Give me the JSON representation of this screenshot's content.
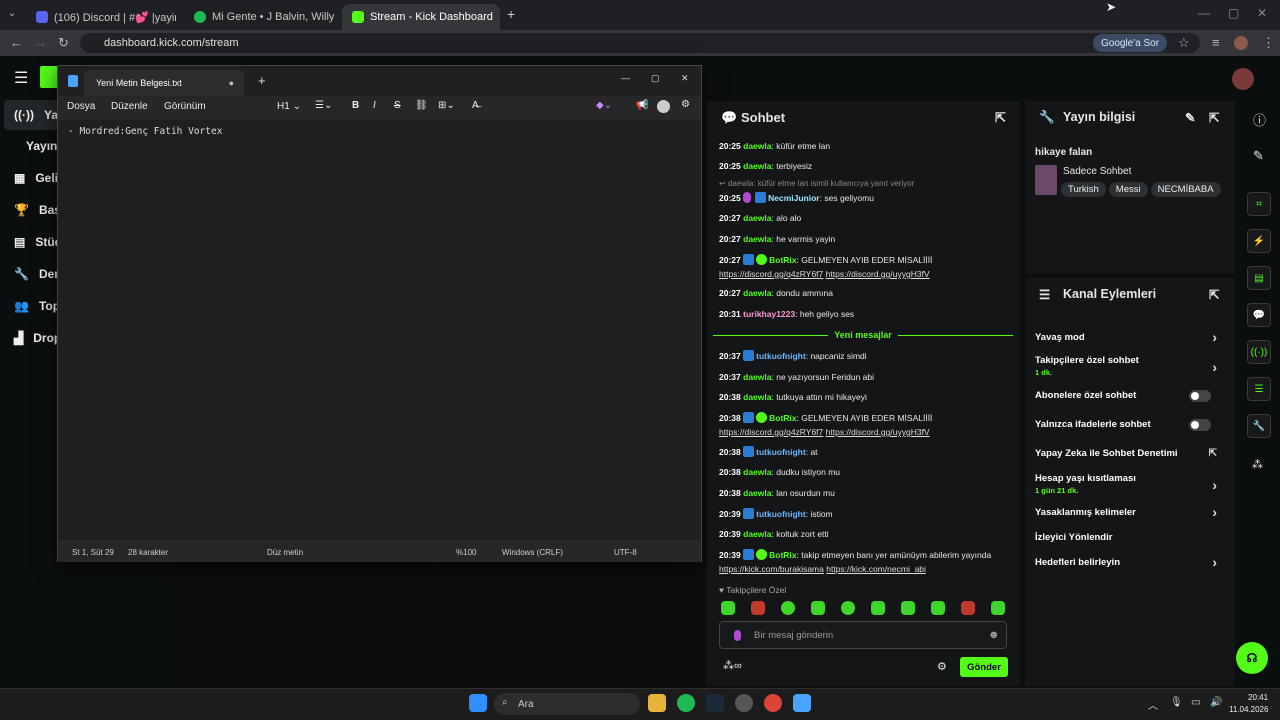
{
  "browser": {
    "tabs": [
      {
        "title": "(106) Discord | #💕 |yayin-duy",
        "color": "#5865f2",
        "active": false
      },
      {
        "title": "Mi Gente • J Balvin, Willy W",
        "color": "#1db954",
        "active": false
      },
      {
        "title": "Stream - Kick Dashboard",
        "color": "#53fc18",
        "active": true
      }
    ],
    "url": "dashboard.kick.com/stream",
    "google_button": "Google'a Sor"
  },
  "sidenav": {
    "items": [
      {
        "label": "Yayı",
        "icon": "broadcast-icon"
      },
      {
        "label": "Yayın",
        "icon": ""
      },
      {
        "label": "Geli",
        "icon": "chart-icon"
      },
      {
        "label": "Başa",
        "icon": "trophy-icon"
      },
      {
        "label": "Stüd",
        "icon": "studio-icon"
      },
      {
        "label": "Den",
        "icon": "wrench-icon"
      },
      {
        "label": "Top",
        "icon": "community-icon"
      },
      {
        "label": "Drop",
        "icon": "drops-icon"
      }
    ]
  },
  "notepad": {
    "tab_title": "Yeni Metin Belgesi.txt",
    "menu": [
      "Dosya",
      "Düzenle",
      "Görünüm"
    ],
    "heading_select": "H1",
    "content": "- Mordred:Genç Fatih Vortex",
    "status": {
      "position": "St 1, Süt 29",
      "chars": "28 karakter",
      "format": "Düz metin",
      "zoom": "%100",
      "eol": "Windows (CRLF)",
      "encoding": "UTF-8"
    }
  },
  "chat": {
    "title": "Sohbet",
    "reply_hint": "daewla: küfür etme lan isimli kullanıcıya yanıt veriyor",
    "new_messages": "Yeni mesajlar",
    "followers_only": "Takipçilere Özel",
    "input_placeholder": "Bir mesaj gönderin",
    "send": "Gönder",
    "messages": [
      {
        "time": "20:25",
        "user": "daewla",
        "cls": "u-g",
        "text": "küfür etme lan"
      },
      {
        "time": "20:25",
        "user": "daewla",
        "cls": "u-g",
        "text": "terbiyesiz"
      },
      {
        "time": "20:25",
        "user": "NecmiJunior",
        "cls": "u-n",
        "text": "ses geliyomu"
      },
      {
        "time": "20:27",
        "user": "daewla",
        "cls": "u-g",
        "text": "alo alo"
      },
      {
        "time": "20:27",
        "user": "daewla",
        "cls": "u-g",
        "text": "he varmis yayin"
      },
      {
        "time": "20:27",
        "user": "BotRix",
        "cls": "u-g",
        "text": "GELMEYEN AYIB EDER MİSALİİİİ",
        "links": [
          "https://discord.gg/q4zRY6f7",
          "https://discord.gg/uyygH3fV"
        ]
      },
      {
        "time": "20:27",
        "user": "daewla",
        "cls": "u-g",
        "text": "dondu ammına"
      },
      {
        "time": "20:31",
        "user": "turikhay1223",
        "cls": "u-p",
        "text": "heh geliyo ses"
      },
      {
        "time": "20:37",
        "user": "tutkuofnight",
        "cls": "u-b",
        "text": "napcaniz simdi"
      },
      {
        "time": "20:37",
        "user": "daewla",
        "cls": "u-g",
        "text": "ne yazıyorsun Feridun abi"
      },
      {
        "time": "20:38",
        "user": "daewla",
        "cls": "u-g",
        "text": "tutkuya attın mi hikayeyi"
      },
      {
        "time": "20:38",
        "user": "BotRix",
        "cls": "u-g",
        "text": "GELMEYEN AYIB EDER MİSALİİİİ",
        "links": [
          "https://discord.gg/q4zRY6f7",
          "https://discord.gg/uyygH3fV"
        ]
      },
      {
        "time": "20:38",
        "user": "tutkuofnight",
        "cls": "u-b",
        "text": "at"
      },
      {
        "time": "20:38",
        "user": "daewla",
        "cls": "u-g",
        "text": "dudku istiyon mu"
      },
      {
        "time": "20:38",
        "user": "daewla",
        "cls": "u-g",
        "text": "lan osurdun mu"
      },
      {
        "time": "20:39",
        "user": "tutkuofnight",
        "cls": "u-b",
        "text": "istiom"
      },
      {
        "time": "20:39",
        "user": "daewla",
        "cls": "u-g",
        "text": "koltuk zort etti"
      },
      {
        "time": "20:39",
        "user": "BotRix",
        "cls": "u-g",
        "text": "takip etmeyen banı yer amünüym abilerim yayında",
        "links": [
          "https://kick.com/burakisama",
          "https://kick.com/necmi_abi"
        ]
      }
    ]
  },
  "stream_info": {
    "title": "Yayın bilgisi",
    "stream_title": "hikaye falan",
    "category": "Sadece Sohbet",
    "tags": [
      "Turkish",
      "Messi",
      "NECMİBABA"
    ]
  },
  "channel_actions": {
    "title": "Kanal Eylemleri",
    "items": [
      {
        "label": "Yavaş mod",
        "sub": "",
        "ctrl": "chev"
      },
      {
        "label": "Takipçilere özel sohbet",
        "sub": "1 dk.",
        "ctrl": "chev"
      },
      {
        "label": "Abonelere özel sohbet",
        "sub": "",
        "ctrl": "toggle"
      },
      {
        "label": "Yalnızca ifadelerle sohbet",
        "sub": "",
        "ctrl": "toggle"
      },
      {
        "label": "Yapay Zeka ile Sohbet Denetimi",
        "sub": "",
        "ctrl": "ext"
      },
      {
        "label": "Hesap yaşı kısıtlaması",
        "sub": "1 gün 21 dk.",
        "ctrl": "chev"
      },
      {
        "label": "Yasaklanmış kelimeler",
        "sub": "",
        "ctrl": "chev"
      },
      {
        "label": "İzleyici Yönlendir",
        "sub": "",
        "ctrl": "none"
      },
      {
        "label": "Hedefleri belirleyin",
        "sub": "",
        "ctrl": "chev"
      }
    ]
  },
  "taskbar": {
    "search": "Ara",
    "time": "20:41",
    "date": "11.04.2026"
  },
  "colors": {
    "accent": "#53fc18",
    "bg": "#0b0e0f",
    "panel": "#131517"
  }
}
